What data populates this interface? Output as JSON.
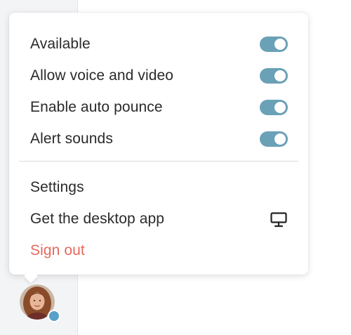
{
  "menu": {
    "toggles": [
      {
        "label": "Available",
        "enabled": true
      },
      {
        "label": "Allow voice and video",
        "enabled": true
      },
      {
        "label": "Enable auto pounce",
        "enabled": true
      },
      {
        "label": "Alert sounds",
        "enabled": true
      }
    ],
    "actions": [
      {
        "label": "Settings"
      },
      {
        "label": "Get the desktop app",
        "icon": "desktop-icon"
      },
      {
        "label": "Sign out",
        "color": "#e5695c"
      }
    ]
  },
  "status": {
    "color": "#5aa1c7"
  },
  "colors": {
    "toggle_on": "#6aa1b7",
    "danger": "#e5695c"
  }
}
